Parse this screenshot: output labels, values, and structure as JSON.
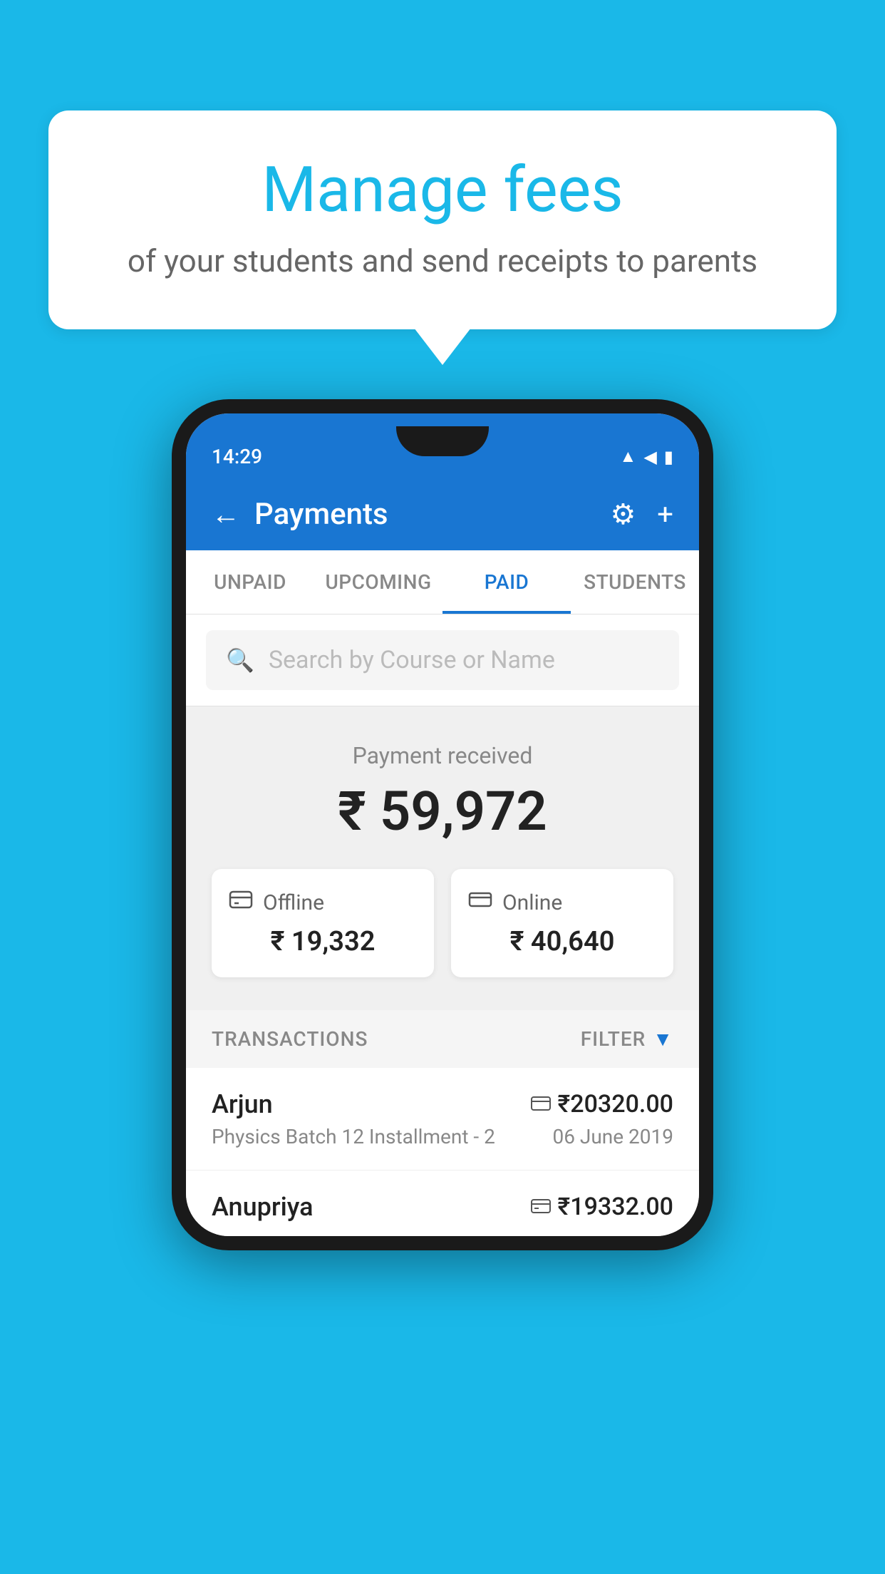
{
  "background_color": "#1ab8e8",
  "speech_bubble": {
    "heading": "Manage fees",
    "subtext": "of your students and send receipts to parents"
  },
  "phone": {
    "status_bar": {
      "time": "14:29",
      "icons": [
        "▲",
        "◀",
        "▮"
      ]
    },
    "header": {
      "title": "Payments",
      "back_label": "←",
      "settings_label": "⚙",
      "add_label": "+"
    },
    "tabs": [
      {
        "label": "UNPAID",
        "active": false
      },
      {
        "label": "UPCOMING",
        "active": false
      },
      {
        "label": "PAID",
        "active": true
      },
      {
        "label": "STUDENTS",
        "active": false
      }
    ],
    "search": {
      "placeholder": "Search by Course or Name"
    },
    "payment_summary": {
      "label": "Payment received",
      "amount": "₹ 59,972",
      "offline": {
        "label": "Offline",
        "amount": "₹ 19,332"
      },
      "online": {
        "label": "Online",
        "amount": "₹ 40,640"
      }
    },
    "transactions_header": {
      "label": "TRANSACTIONS",
      "filter_label": "FILTER"
    },
    "transactions": [
      {
        "name": "Arjun",
        "amount": "₹20320.00",
        "course": "Physics Batch 12 Installment - 2",
        "date": "06 June 2019",
        "payment_type": "online"
      },
      {
        "name": "Anupriya",
        "amount": "₹19332.00",
        "course": "",
        "date": "",
        "payment_type": "offline"
      }
    ]
  }
}
